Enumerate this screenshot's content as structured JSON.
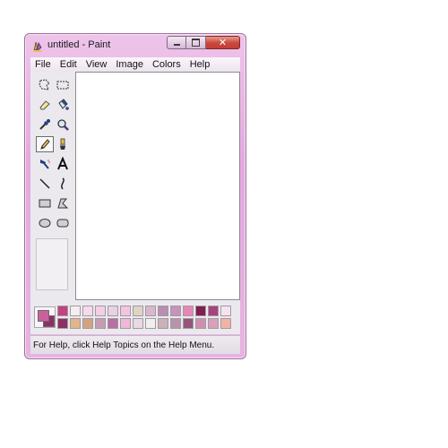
{
  "window": {
    "title": "untitled - Paint"
  },
  "menu": {
    "items": [
      "File",
      "Edit",
      "View",
      "Image",
      "Colors",
      "Help"
    ]
  },
  "toolbox": {
    "tools": [
      "free-form-select-icon",
      "select-icon",
      "eraser-icon",
      "fill-with-color-icon",
      "pick-color-icon",
      "magnifier-icon",
      "pencil-icon",
      "brush-icon",
      "airbrush-icon",
      "text-icon",
      "line-icon",
      "curve-icon",
      "rectangle-icon",
      "polygon-icon",
      "ellipse-icon",
      "rounded-rectangle-icon"
    ],
    "selected_tool": "pencil-icon"
  },
  "palette": {
    "foreground": "#c8629c",
    "background": "#8e2f62",
    "colors_top": [
      "#c0437c",
      "#f4eef2",
      "#f7d9ec",
      "#f2cfe3",
      "#e7d2e6",
      "#f3c6df",
      "#ddd4c4",
      "#d9b6cc",
      "#b98fb0",
      "#c993b9",
      "#e887b6",
      "#7f1f4d",
      "#a7437d",
      "#f6e3ee"
    ],
    "colors_bottom": [
      "#8e2f62",
      "#e1b68a",
      "#d3a27e",
      "#c69cb0",
      "#b86fa3",
      "#f0b7d8",
      "#e8d9e3",
      "#efefee",
      "#c9b2ba",
      "#b894aa",
      "#955579",
      "#d08fb0",
      "#d9a1b9",
      "#f3b3a2"
    ]
  },
  "status": {
    "text": "For Help, click Help Topics on the Help Menu."
  }
}
